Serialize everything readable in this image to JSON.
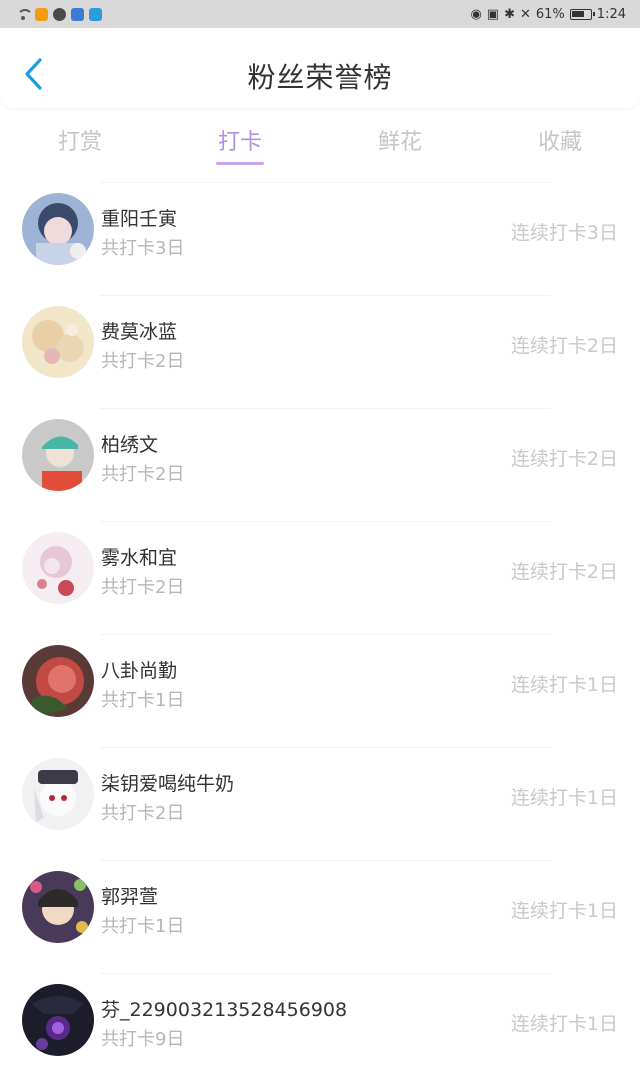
{
  "status_bar": {
    "battery_percent": "61%",
    "time": "1:24"
  },
  "header": {
    "title": "粉丝荣誉榜",
    "back_icon": "chevron-left-icon"
  },
  "tabs": [
    {
      "label": "打赏",
      "active": false
    },
    {
      "label": "打卡",
      "active": true
    },
    {
      "label": "鲜花",
      "active": false
    },
    {
      "label": "收藏",
      "active": false
    }
  ],
  "colors": {
    "accent": "#b48ee0",
    "back_arrow": "#1e9be6"
  },
  "fans": [
    {
      "name": "重阳壬寅",
      "total": "共打卡3日",
      "streak": "连续打卡3日"
    },
    {
      "name": "费莫冰蓝",
      "total": "共打卡2日",
      "streak": "连续打卡2日"
    },
    {
      "name": "柏绣文",
      "total": "共打卡2日",
      "streak": "连续打卡2日"
    },
    {
      "name": "雾水和宜",
      "total": "共打卡2日",
      "streak": "连续打卡2日"
    },
    {
      "name": "八卦尚勤",
      "total": "共打卡1日",
      "streak": "连续打卡1日"
    },
    {
      "name": "柒钥爱喝纯牛奶",
      "total": "共打卡2日",
      "streak": "连续打卡1日"
    },
    {
      "name": "郭羿萱",
      "total": "共打卡1日",
      "streak": "连续打卡1日"
    },
    {
      "name": "芬_229003213528456908",
      "total": "共打卡9日",
      "streak": "连续打卡1日"
    }
  ]
}
